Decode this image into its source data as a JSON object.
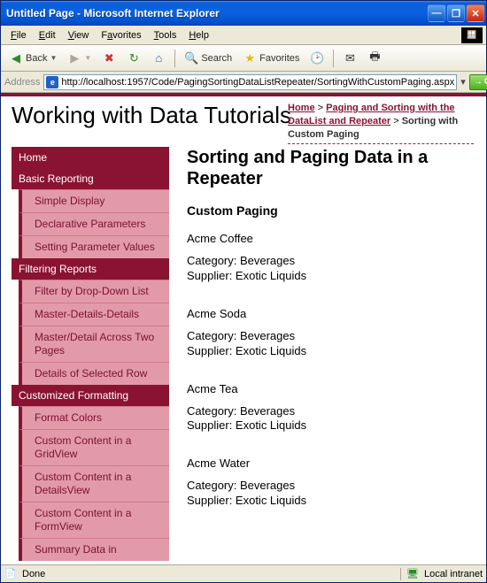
{
  "window": {
    "title": "Untitled Page - Microsoft Internet Explorer"
  },
  "menu": {
    "file": "File",
    "edit": "Edit",
    "view": "View",
    "favorites": "Favorites",
    "tools": "Tools",
    "help": "Help"
  },
  "toolbar": {
    "back": "Back",
    "search": "Search",
    "favorites": "Favorites"
  },
  "address": {
    "label": "Address",
    "url": "http://localhost:1957/Code/PagingSortingDataListRepeater/SortingWithCustomPaging.aspx",
    "go": "Go"
  },
  "page": {
    "title": "Working with Data Tutorials"
  },
  "breadcrumb": {
    "home": "Home",
    "section": "Paging and Sorting with the DataList and Repeater",
    "current": "Sorting with Custom Paging"
  },
  "sidebar": {
    "home": "Home",
    "basic": "Basic Reporting",
    "basic_items": [
      "Simple Display",
      "Declarative Parameters",
      "Setting Parameter Values"
    ],
    "filtering": "Filtering Reports",
    "filtering_items": [
      "Filter by Drop-Down List",
      "Master-Details-Details",
      "Master/Detail Across Two Pages",
      "Details of Selected Row"
    ],
    "custom": "Customized Formatting",
    "custom_items": [
      "Format Colors",
      "Custom Content in a GridView",
      "Custom Content in a DetailsView",
      "Custom Content in a FormView",
      "Summary Data in"
    ]
  },
  "main": {
    "h1": "Sorting and Paging Data in a Repeater",
    "h2": "Custom Paging",
    "products": [
      {
        "name": "Acme Coffee",
        "category": "Beverages",
        "supplier": "Exotic Liquids"
      },
      {
        "name": "Acme Soda",
        "category": "Beverages",
        "supplier": "Exotic Liquids"
      },
      {
        "name": "Acme Tea",
        "category": "Beverages",
        "supplier": "Exotic Liquids"
      },
      {
        "name": "Acme Water",
        "category": "Beverages",
        "supplier": "Exotic Liquids"
      }
    ],
    "cat_label": "Category: ",
    "sup_label": "Supplier: "
  },
  "status": {
    "done": "Done",
    "zone": "Local intranet"
  }
}
